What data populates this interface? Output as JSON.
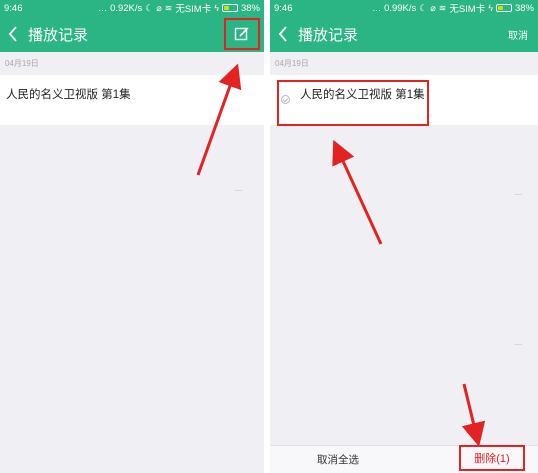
{
  "colors": {
    "accent": "#2bb584",
    "highlight": "#e32222",
    "background": "#efeff4"
  },
  "left": {
    "status": {
      "time": "9:46",
      "speed": "0.92K/s",
      "carrier": "无SIM卡",
      "battery": "38%",
      "battery_level": 0.38
    },
    "header": {
      "back_icon": "chevron-left-icon",
      "title": "播放记录",
      "edit_icon": "edit-icon"
    },
    "date": "04月19日",
    "item": {
      "title": "人民的名义卫视版 第1集"
    }
  },
  "right": {
    "status": {
      "time": "9:46",
      "speed": "0.99K/s",
      "carrier": "无SIM卡",
      "battery": "38%",
      "battery_level": 0.38
    },
    "header": {
      "back_icon": "chevron-left-icon",
      "title": "播放记录",
      "cancel_label": "取消"
    },
    "date": "04月19日",
    "item": {
      "title": "人民的名义卫视版 第1集",
      "checkbox_icon": "check-circle-icon"
    },
    "footer": {
      "select_all_label": "取消全选",
      "delete_label": "删除(1)"
    }
  }
}
